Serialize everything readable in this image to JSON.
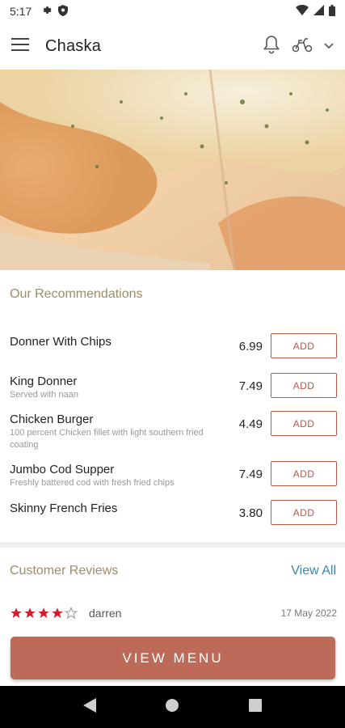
{
  "status": {
    "time": "5:17",
    "icons": [
      "settings-icon",
      "shield-icon",
      "wifi-icon",
      "signal-icon",
      "battery-icon"
    ]
  },
  "app_bar": {
    "title": "Chaska",
    "icons": [
      "menu-icon",
      "bell-icon",
      "scooter-icon",
      "chevron-down-icon"
    ]
  },
  "recommendations": {
    "title": "Our Recommendations",
    "add_label": "ADD",
    "items": [
      {
        "name": "Donner With Chips",
        "desc": "",
        "price": "6.99"
      },
      {
        "name": "King Donner",
        "desc": "Served with naan",
        "price": "7.49"
      },
      {
        "name": "Chicken Burger",
        "desc": "100 percent Chicken fillet with light southern fried coating",
        "price": "4.49"
      },
      {
        "name": "Jumbo Cod Supper",
        "desc": "Freshly battered cod with fresh fried chips",
        "price": "7.49"
      },
      {
        "name": "Skinny French Fries",
        "desc": "",
        "price": "3.80"
      }
    ]
  },
  "reviews": {
    "title": "Customer Reviews",
    "view_all": "View All",
    "items": [
      {
        "rating": 4,
        "max": 5,
        "name": "darren",
        "date": "17 May 2022"
      }
    ]
  },
  "cta": {
    "label": "VIEW MENU"
  },
  "colors": {
    "accent": "#bd6a59",
    "add_border": "#b9574b",
    "section_title": "#a08b67",
    "link": "#3a87ad",
    "star": "#d21f2b"
  }
}
